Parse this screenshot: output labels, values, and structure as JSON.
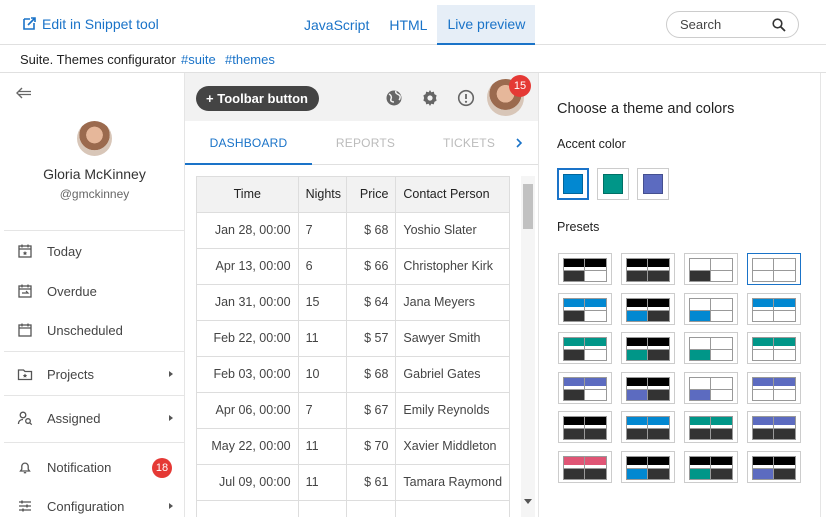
{
  "topbar": {
    "snippet_link": "Edit in Snippet tool",
    "tabs": [
      {
        "label": "JavaScript",
        "active": false
      },
      {
        "label": "HTML",
        "active": false
      },
      {
        "label": "Live preview",
        "active": true
      }
    ],
    "search_label": "Search"
  },
  "subbar": {
    "title": "Suite. Themes configurator",
    "tags": [
      "#suite",
      "#themes"
    ]
  },
  "sidebar": {
    "user_name": "Gloria McKinney",
    "user_handle": "@gmckinney",
    "items": [
      {
        "label": "Today",
        "icon": "calendar-star-icon"
      },
      {
        "label": "Overdue",
        "icon": "calendar-repeat-icon"
      },
      {
        "label": "Unscheduled",
        "icon": "calendar-blank-icon"
      },
      {
        "label": "Projects",
        "icon": "folder-star-icon",
        "expandable": true
      },
      {
        "label": "Assigned",
        "icon": "person-search-icon",
        "expandable": true
      },
      {
        "label": "Notification",
        "icon": "bell-icon",
        "badge": "18"
      },
      {
        "label": "Configuration",
        "icon": "tune-icon",
        "expandable": true
      }
    ]
  },
  "toolbar": {
    "button_label": "Toolbar button",
    "avatar_badge": "15"
  },
  "tabs": [
    {
      "label": "DASHBOARD",
      "active": true
    },
    {
      "label": "REPORTS",
      "active": false
    },
    {
      "label": "TICKETS",
      "active": false
    }
  ],
  "grid": {
    "columns": [
      "Time",
      "Nights",
      "Price",
      "Contact Person"
    ],
    "rows": [
      [
        "Jan 28, 00:00",
        "7",
        "$ 68",
        "Yoshio Slater"
      ],
      [
        "Apr 13, 00:00",
        "6",
        "$ 66",
        "Christopher Kirk"
      ],
      [
        "Jan 31, 00:00",
        "15",
        "$ 64",
        "Jana Meyers"
      ],
      [
        "Feb 22, 00:00",
        "11",
        "$ 57",
        "Sawyer Smith"
      ],
      [
        "Feb 03, 00:00",
        "10",
        "$ 68",
        "Gabriel Gates"
      ],
      [
        "Apr 06, 00:00",
        "7",
        "$ 67",
        "Emily Reynolds"
      ],
      [
        "May 22, 00:00",
        "11",
        "$ 70",
        "Xavier Middleton"
      ],
      [
        "Jul 09, 00:00",
        "11",
        "$ 61",
        "Tamara Raymond"
      ],
      [
        "",
        "",
        "",
        ""
      ]
    ]
  },
  "theme_panel": {
    "title": "Choose a theme and colors",
    "accent_label": "Accent color",
    "accent_colors": [
      "#0288d1",
      "#009688",
      "#5c6bc0"
    ],
    "selected_accent": 0,
    "presets_label": "Presets",
    "preset_accents": [
      "#222222",
      "#0288d1",
      "#009688",
      "#5c6bc0",
      "#222222",
      "#e05575"
    ]
  }
}
